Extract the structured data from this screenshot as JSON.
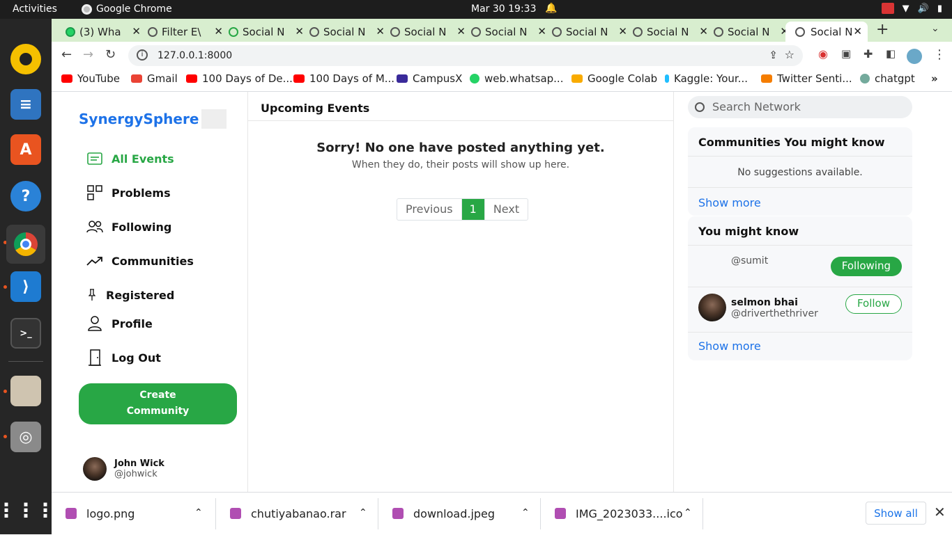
{
  "topbar": {
    "activities": "Activities",
    "app": "Google Chrome",
    "clock": "Mar 30  19:33"
  },
  "tabs": [
    {
      "title": "(3) Wha",
      "icon": "whatsapp-icon"
    },
    {
      "title": "Filter E\\",
      "icon": "chatgpt-icon"
    },
    {
      "title": "Social N",
      "icon": "social-icon"
    },
    {
      "title": "Social N",
      "icon": "globe-icon"
    },
    {
      "title": "Social N",
      "icon": "globe-icon"
    },
    {
      "title": "Social N",
      "icon": "globe-icon"
    },
    {
      "title": "Social N",
      "icon": "globe-icon"
    },
    {
      "title": "Social N",
      "icon": "globe-icon"
    },
    {
      "title": "Social N",
      "icon": "globe-icon"
    },
    {
      "title": "Social N",
      "icon": "globe-icon"
    }
  ],
  "address": {
    "url": "127.0.0.1:8000"
  },
  "bookmarks": [
    "YouTube",
    "Gmail",
    "100 Days of De...",
    "100 Days of M...",
    "CampusX",
    "web.whatsap...",
    "Google Colab",
    "Kaggle: Your...",
    "Twitter Senti...",
    "chatgpt"
  ],
  "site": {
    "brand": "SynergySphere",
    "nav": {
      "all_events": "All Events",
      "problems": "Problems",
      "following": "Following",
      "communities": "Communities",
      "registered": "Registered",
      "profile": "Profile",
      "logout": "Log Out"
    },
    "create_line1": "Create",
    "create_line2": "Community",
    "user": {
      "name": "John Wick",
      "handle": "@johwick"
    }
  },
  "center": {
    "heading": "Upcoming Events",
    "empty_title": "Sorry! No one have posted anything yet.",
    "empty_sub": "When they do, their posts will show up here.",
    "pager": {
      "prev": "Previous",
      "current": "1",
      "next": "Next"
    }
  },
  "right": {
    "search_placeholder": "Search Network",
    "communities": {
      "title": "Communities You might know",
      "empty": "No suggestions available.",
      "more": "Show more"
    },
    "people": {
      "title": "You might know",
      "rows": [
        {
          "name": "",
          "handle": "@sumit",
          "action": "Following"
        },
        {
          "name": "selmon bhai",
          "handle": "@driverthethriver",
          "action": "Follow"
        }
      ],
      "more": "Show more"
    }
  },
  "downloads": {
    "files": [
      "logo.png",
      "chutiyabanao.rar",
      "download.jpeg",
      "IMG_2023033....ico"
    ],
    "show_all": "Show all"
  }
}
